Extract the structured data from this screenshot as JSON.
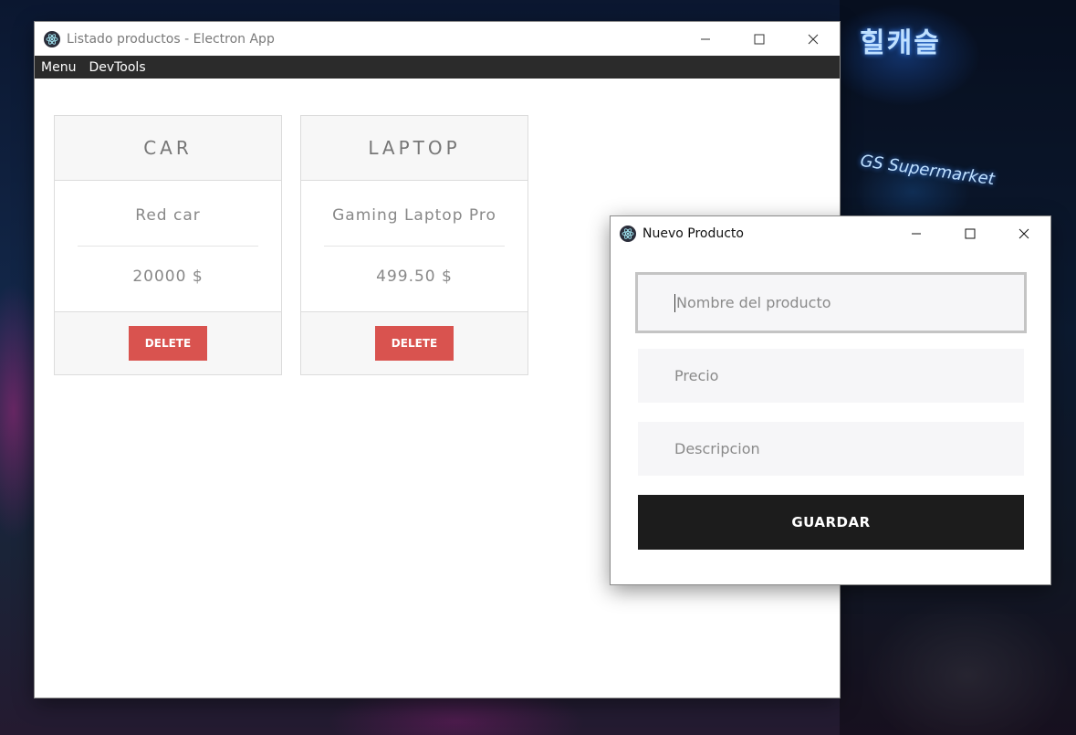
{
  "main_window": {
    "title": "Listado productos - Electron App",
    "menu": [
      "Menu",
      "DevTools"
    ],
    "products": [
      {
        "title": "CAR",
        "name": "Red car",
        "price": "20000 $",
        "delete_label": "DELETE"
      },
      {
        "title": "LAPTOP",
        "name": "Gaming Laptop Pro",
        "price": "499.50 $",
        "delete_label": "DELETE"
      }
    ]
  },
  "dialog": {
    "title": "Nuevo Producto",
    "fields": [
      {
        "placeholder": "Nombre del producto"
      },
      {
        "placeholder": "Precio"
      },
      {
        "placeholder": "Descripcion"
      }
    ],
    "save_label": "GUARDAR"
  },
  "background": {
    "sign_korean": "힐캐슬",
    "sign_market": "GS Supermarket"
  },
  "colors": {
    "menubar": "#2b2b2b",
    "delete_button": "#d9534f",
    "save_button": "#1c1c1c"
  },
  "icons": [
    "electron-app-icon",
    "minimize-icon",
    "maximize-icon",
    "close-icon"
  ]
}
